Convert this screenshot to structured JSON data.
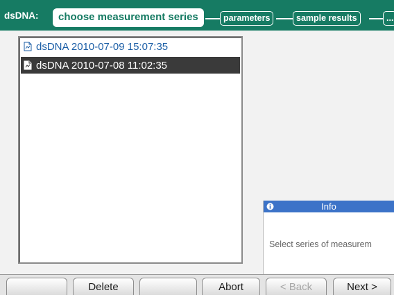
{
  "header": {
    "app_label": "dsDNA:",
    "steps": [
      {
        "label": "choose measurement series",
        "active": true
      },
      {
        "label": "parameters",
        "active": false
      },
      {
        "label": "sample results",
        "active": false
      },
      {
        "label": "...",
        "active": false
      }
    ]
  },
  "series_list": {
    "items": [
      {
        "label": "dsDNA 2010-07-09 15:07:35",
        "selected": false,
        "icon": "document-icon"
      },
      {
        "label": "dsDNA 2010-07-08 11:02:35",
        "selected": true,
        "icon": "document-icon"
      }
    ]
  },
  "info": {
    "title": "Info",
    "icon": "info-icon",
    "text": "Select series of measurem"
  },
  "buttons": {
    "button_1": "",
    "delete": "Delete",
    "button_3": "",
    "abort": "Abort",
    "back": "< Back",
    "next": "Next >"
  },
  "colors": {
    "header_bg": "#167b63",
    "selection_bg": "#3a3a3a",
    "link_text": "#1b5ea6",
    "info_bar": "#3c73c8"
  }
}
